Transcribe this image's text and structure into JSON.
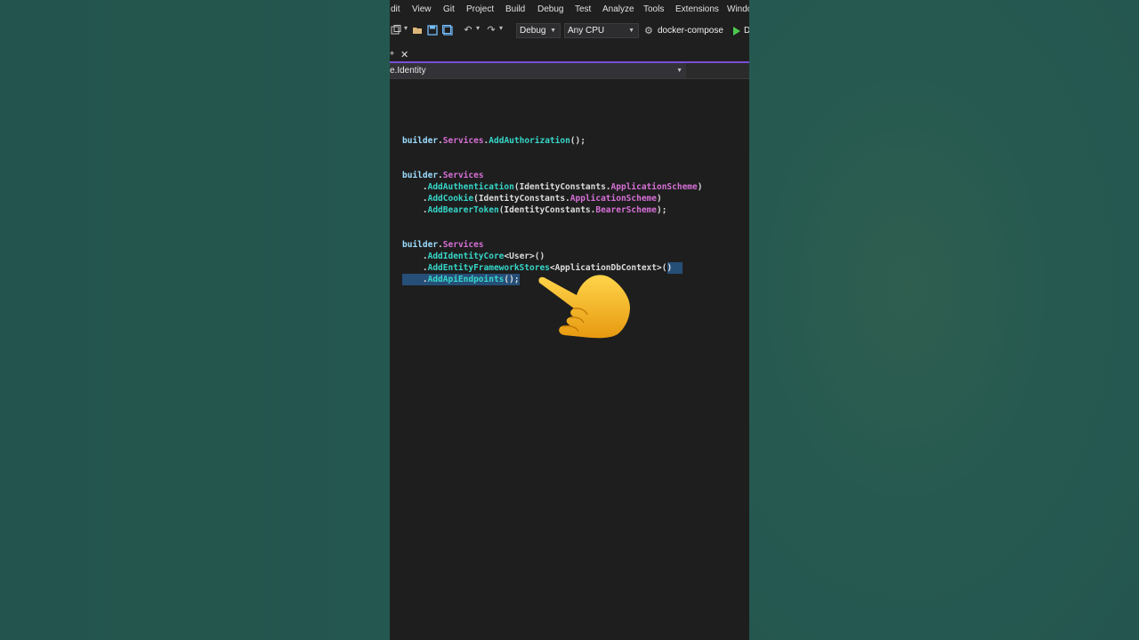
{
  "menu": {
    "items": [
      "dit",
      "View",
      "Git",
      "Project",
      "Build",
      "Debug",
      "Test",
      "Analyze",
      "Tools",
      "Extensions",
      "Windo"
    ]
  },
  "toolbar": {
    "config_value": "Debug",
    "platform_value": "Any CPU",
    "startup_project": "docker-compose",
    "run_label": "D"
  },
  "tab": {
    "pin_glyph": "⌖",
    "close_glyph": "✕"
  },
  "navbar": {
    "scope_value": "e.Identity"
  },
  "code": {
    "l1": {
      "a": "builder",
      "b": ".",
      "c": "Services",
      "d": ".",
      "e": "AddAuthorization",
      "f": "();"
    },
    "l2": {
      "a": "builder",
      "b": ".",
      "c": "Services"
    },
    "l3": {
      "a": "    .",
      "b": "AddAuthentication",
      "c": "(IdentityConstants.",
      "d": "ApplicationScheme",
      "e": ")"
    },
    "l4": {
      "a": "    .",
      "b": "AddCookie",
      "c": "(IdentityConstants.",
      "d": "ApplicationScheme",
      "e": ")"
    },
    "l5": {
      "a": "    .",
      "b": "AddBearerToken",
      "c": "(IdentityConstants.",
      "d": "BearerScheme",
      "e": ");"
    },
    "l6": {
      "a": "builder",
      "b": ".",
      "c": "Services"
    },
    "l7": {
      "a": "    .",
      "b": "AddIdentityCore",
      "c": "<User>()"
    },
    "l8": {
      "a": "    .",
      "b": "AddEntityFrameworkStores",
      "c": "<ApplicationDbContext>()"
    },
    "l9": {
      "a": "    .",
      "b": "AddApiEndpoints",
      "c": "();"
    }
  },
  "colors": {
    "background": "#24564f",
    "ide_bg": "#1e1e1e",
    "accent": "#7a4ed6",
    "selection": "#264f78",
    "method": "#36d7c9",
    "property": "#d670d6",
    "hand": "#f5b820"
  },
  "icons": {
    "cursor": "pointing-hand-icon"
  }
}
